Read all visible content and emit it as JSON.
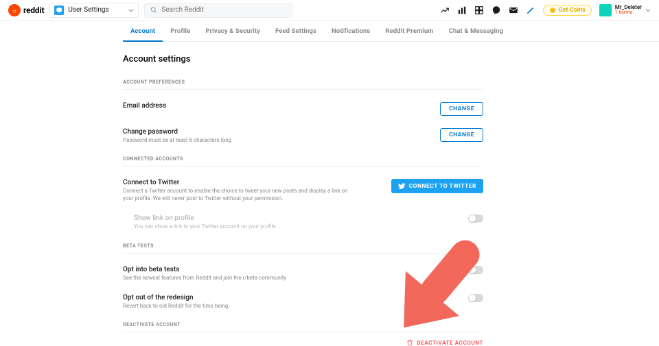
{
  "header": {
    "brand": "reddit",
    "nav_label": "User Settings",
    "search_placeholder": "Search Reddit",
    "coins_label": "Get Coins",
    "username": "Mr_Deleter",
    "karma": "1 karma"
  },
  "tabs": [
    {
      "label": "Account",
      "active": true
    },
    {
      "label": "Profile"
    },
    {
      "label": "Privacy & Security"
    },
    {
      "label": "Feed Settings"
    },
    {
      "label": "Notifications"
    },
    {
      "label": "Reddit Premium"
    },
    {
      "label": "Chat & Messaging"
    }
  ],
  "page_title": "Account settings",
  "sections": {
    "prefs": {
      "heading": "Account preferences",
      "email": {
        "title": "Email address",
        "btn": "Change"
      },
      "password": {
        "title": "Change password",
        "desc": "Password must be at least 6 characters long",
        "btn": "Change"
      }
    },
    "connected": {
      "heading": "Connected accounts",
      "twitter": {
        "title": "Connect to Twitter",
        "desc": "Connect a Twitter account to enable the choice to tweet your new posts and display a link on your profile. We will never post to Twitter without your permission.",
        "btn": "Connect to Twitter"
      },
      "showlink": {
        "title": "Show link on profile",
        "desc": "You can show a link to your Twitter account on your profile"
      }
    },
    "beta": {
      "heading": "Beta tests",
      "optin": {
        "title": "Opt into beta tests",
        "desc": "See the newest features from Reddit and join the r/beta community"
      },
      "optout": {
        "title": "Opt out of the redesign",
        "desc": "Revert back to old Reddit for the time being"
      }
    },
    "deactivate": {
      "heading": "Deactivate account",
      "btn": "Deactivate account"
    }
  }
}
